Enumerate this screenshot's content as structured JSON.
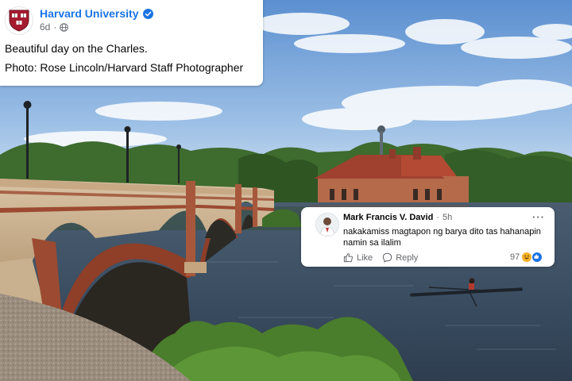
{
  "post": {
    "author": "Harvard University",
    "time": "6d",
    "meta_separator": "·",
    "lines": [
      "Beautiful day on the Charles.",
      "Photo: Rose Lincoln/Harvard Staff Photographer"
    ],
    "avatar_icon": "harvard-shield-icon",
    "verified_icon": "verified-badge-icon",
    "audience_icon": "globe-icon"
  },
  "comment": {
    "author": "Mark Francis V. David",
    "separator": "·",
    "time": "5h",
    "text": "nakakamiss magtapon ng barya dito tas hahanapin namin sa ilalim",
    "more": "···",
    "like_label": "Like",
    "reply_label": "Reply",
    "reaction_count": "97",
    "reaction_icons": [
      "haha-reaction-icon",
      "like-reaction-icon"
    ]
  },
  "colors": {
    "brand_blue": "#1b74e4",
    "harvard_crimson": "#a51c30",
    "secondary_text": "#65676b",
    "primary_text": "#050505"
  }
}
